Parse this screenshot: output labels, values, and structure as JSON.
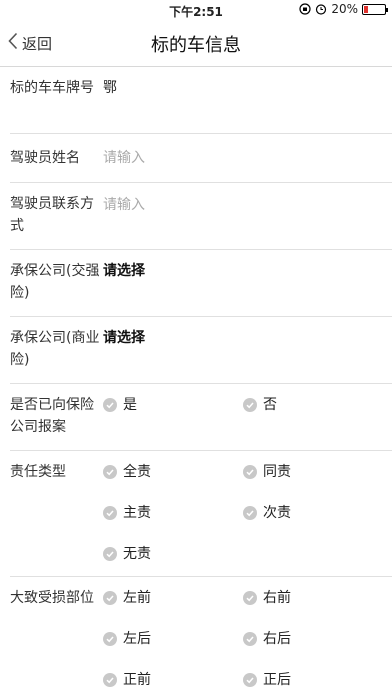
{
  "status_bar": {
    "time": "下午2:51",
    "battery": "20%",
    "battery_level": 0.2,
    "battery_color": "#e0322e"
  },
  "nav": {
    "back_label": "返回",
    "title": "标的车信息"
  },
  "form": {
    "plate": {
      "label": "标的车车牌号",
      "value": "鄂"
    },
    "driver_name": {
      "label": "驾驶员姓名",
      "placeholder": "请输入"
    },
    "driver_contact": {
      "label": "驾驶员联系方式",
      "placeholder": "请输入"
    },
    "insurer_compulsory": {
      "label": "承保公司(交强险)",
      "value": "请选择"
    },
    "insurer_commercial": {
      "label": "承保公司(商业险)",
      "value": "请选择"
    },
    "reported": {
      "label": "是否已向保险公司报案",
      "options": [
        "是",
        "否"
      ]
    },
    "liability": {
      "label": "责任类型",
      "options": [
        "全责",
        "同责",
        "主责",
        "次责",
        "无责"
      ]
    },
    "damage_area": {
      "label": "大致受损部位",
      "options": [
        "左前",
        "右前",
        "左后",
        "右后",
        "正前",
        "正后"
      ]
    }
  }
}
